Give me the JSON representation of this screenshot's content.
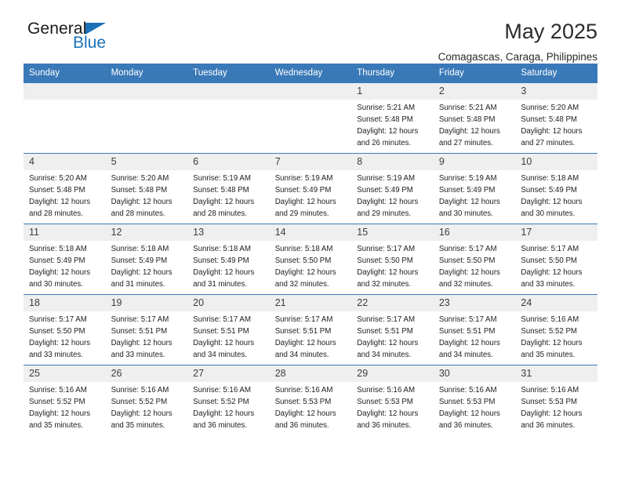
{
  "brand": {
    "name_part1": "General",
    "name_part2": "Blue",
    "accent_color": "#1b72b8"
  },
  "header": {
    "title": "May 2025",
    "location": "Comagascas, Caraga, Philippines"
  },
  "calendar": {
    "header_color": "#3a79b8",
    "weekdays": [
      "Sunday",
      "Monday",
      "Tuesday",
      "Wednesday",
      "Thursday",
      "Friday",
      "Saturday"
    ],
    "weeks": [
      [
        {
          "day": ""
        },
        {
          "day": ""
        },
        {
          "day": ""
        },
        {
          "day": ""
        },
        {
          "day": "1",
          "sunrise": "Sunrise: 5:21 AM",
          "sunset": "Sunset: 5:48 PM",
          "daylight1": "Daylight: 12 hours",
          "daylight2": "and 26 minutes."
        },
        {
          "day": "2",
          "sunrise": "Sunrise: 5:21 AM",
          "sunset": "Sunset: 5:48 PM",
          "daylight1": "Daylight: 12 hours",
          "daylight2": "and 27 minutes."
        },
        {
          "day": "3",
          "sunrise": "Sunrise: 5:20 AM",
          "sunset": "Sunset: 5:48 PM",
          "daylight1": "Daylight: 12 hours",
          "daylight2": "and 27 minutes."
        }
      ],
      [
        {
          "day": "4",
          "sunrise": "Sunrise: 5:20 AM",
          "sunset": "Sunset: 5:48 PM",
          "daylight1": "Daylight: 12 hours",
          "daylight2": "and 28 minutes."
        },
        {
          "day": "5",
          "sunrise": "Sunrise: 5:20 AM",
          "sunset": "Sunset: 5:48 PM",
          "daylight1": "Daylight: 12 hours",
          "daylight2": "and 28 minutes."
        },
        {
          "day": "6",
          "sunrise": "Sunrise: 5:19 AM",
          "sunset": "Sunset: 5:48 PM",
          "daylight1": "Daylight: 12 hours",
          "daylight2": "and 28 minutes."
        },
        {
          "day": "7",
          "sunrise": "Sunrise: 5:19 AM",
          "sunset": "Sunset: 5:49 PM",
          "daylight1": "Daylight: 12 hours",
          "daylight2": "and 29 minutes."
        },
        {
          "day": "8",
          "sunrise": "Sunrise: 5:19 AM",
          "sunset": "Sunset: 5:49 PM",
          "daylight1": "Daylight: 12 hours",
          "daylight2": "and 29 minutes."
        },
        {
          "day": "9",
          "sunrise": "Sunrise: 5:19 AM",
          "sunset": "Sunset: 5:49 PM",
          "daylight1": "Daylight: 12 hours",
          "daylight2": "and 30 minutes."
        },
        {
          "day": "10",
          "sunrise": "Sunrise: 5:18 AM",
          "sunset": "Sunset: 5:49 PM",
          "daylight1": "Daylight: 12 hours",
          "daylight2": "and 30 minutes."
        }
      ],
      [
        {
          "day": "11",
          "sunrise": "Sunrise: 5:18 AM",
          "sunset": "Sunset: 5:49 PM",
          "daylight1": "Daylight: 12 hours",
          "daylight2": "and 30 minutes."
        },
        {
          "day": "12",
          "sunrise": "Sunrise: 5:18 AM",
          "sunset": "Sunset: 5:49 PM",
          "daylight1": "Daylight: 12 hours",
          "daylight2": "and 31 minutes."
        },
        {
          "day": "13",
          "sunrise": "Sunrise: 5:18 AM",
          "sunset": "Sunset: 5:49 PM",
          "daylight1": "Daylight: 12 hours",
          "daylight2": "and 31 minutes."
        },
        {
          "day": "14",
          "sunrise": "Sunrise: 5:18 AM",
          "sunset": "Sunset: 5:50 PM",
          "daylight1": "Daylight: 12 hours",
          "daylight2": "and 32 minutes."
        },
        {
          "day": "15",
          "sunrise": "Sunrise: 5:17 AM",
          "sunset": "Sunset: 5:50 PM",
          "daylight1": "Daylight: 12 hours",
          "daylight2": "and 32 minutes."
        },
        {
          "day": "16",
          "sunrise": "Sunrise: 5:17 AM",
          "sunset": "Sunset: 5:50 PM",
          "daylight1": "Daylight: 12 hours",
          "daylight2": "and 32 minutes."
        },
        {
          "day": "17",
          "sunrise": "Sunrise: 5:17 AM",
          "sunset": "Sunset: 5:50 PM",
          "daylight1": "Daylight: 12 hours",
          "daylight2": "and 33 minutes."
        }
      ],
      [
        {
          "day": "18",
          "sunrise": "Sunrise: 5:17 AM",
          "sunset": "Sunset: 5:50 PM",
          "daylight1": "Daylight: 12 hours",
          "daylight2": "and 33 minutes."
        },
        {
          "day": "19",
          "sunrise": "Sunrise: 5:17 AM",
          "sunset": "Sunset: 5:51 PM",
          "daylight1": "Daylight: 12 hours",
          "daylight2": "and 33 minutes."
        },
        {
          "day": "20",
          "sunrise": "Sunrise: 5:17 AM",
          "sunset": "Sunset: 5:51 PM",
          "daylight1": "Daylight: 12 hours",
          "daylight2": "and 34 minutes."
        },
        {
          "day": "21",
          "sunrise": "Sunrise: 5:17 AM",
          "sunset": "Sunset: 5:51 PM",
          "daylight1": "Daylight: 12 hours",
          "daylight2": "and 34 minutes."
        },
        {
          "day": "22",
          "sunrise": "Sunrise: 5:17 AM",
          "sunset": "Sunset: 5:51 PM",
          "daylight1": "Daylight: 12 hours",
          "daylight2": "and 34 minutes."
        },
        {
          "day": "23",
          "sunrise": "Sunrise: 5:17 AM",
          "sunset": "Sunset: 5:51 PM",
          "daylight1": "Daylight: 12 hours",
          "daylight2": "and 34 minutes."
        },
        {
          "day": "24",
          "sunrise": "Sunrise: 5:16 AM",
          "sunset": "Sunset: 5:52 PM",
          "daylight1": "Daylight: 12 hours",
          "daylight2": "and 35 minutes."
        }
      ],
      [
        {
          "day": "25",
          "sunrise": "Sunrise: 5:16 AM",
          "sunset": "Sunset: 5:52 PM",
          "daylight1": "Daylight: 12 hours",
          "daylight2": "and 35 minutes."
        },
        {
          "day": "26",
          "sunrise": "Sunrise: 5:16 AM",
          "sunset": "Sunset: 5:52 PM",
          "daylight1": "Daylight: 12 hours",
          "daylight2": "and 35 minutes."
        },
        {
          "day": "27",
          "sunrise": "Sunrise: 5:16 AM",
          "sunset": "Sunset: 5:52 PM",
          "daylight1": "Daylight: 12 hours",
          "daylight2": "and 36 minutes."
        },
        {
          "day": "28",
          "sunrise": "Sunrise: 5:16 AM",
          "sunset": "Sunset: 5:53 PM",
          "daylight1": "Daylight: 12 hours",
          "daylight2": "and 36 minutes."
        },
        {
          "day": "29",
          "sunrise": "Sunrise: 5:16 AM",
          "sunset": "Sunset: 5:53 PM",
          "daylight1": "Daylight: 12 hours",
          "daylight2": "and 36 minutes."
        },
        {
          "day": "30",
          "sunrise": "Sunrise: 5:16 AM",
          "sunset": "Sunset: 5:53 PM",
          "daylight1": "Daylight: 12 hours",
          "daylight2": "and 36 minutes."
        },
        {
          "day": "31",
          "sunrise": "Sunrise: 5:16 AM",
          "sunset": "Sunset: 5:53 PM",
          "daylight1": "Daylight: 12 hours",
          "daylight2": "and 36 minutes."
        }
      ]
    ]
  }
}
